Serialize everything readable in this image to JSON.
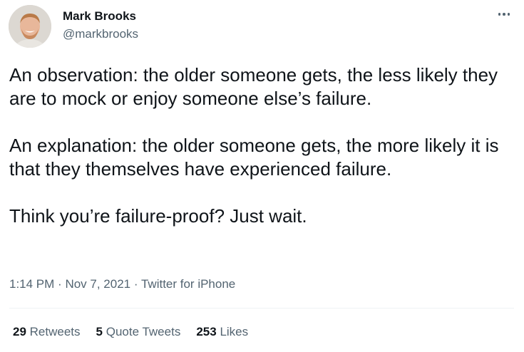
{
  "author": {
    "name": "Mark Brooks",
    "handle": "@markbrooks"
  },
  "tweet": {
    "paragraphs": [
      "An observation: the older someone gets, the less likely they are to mock or enjoy someone else’s failure.",
      "An explanation: the older someone gets, the more likely it is that they themselves have experienced failure.",
      "Think you’re failure-proof? Just wait."
    ]
  },
  "meta": {
    "time": "1:14 PM",
    "separator": "·",
    "date": "Nov 7, 2021",
    "source": "Twitter for iPhone"
  },
  "stats": {
    "retweets": {
      "count": "29",
      "label": "Retweets"
    },
    "quote_tweets": {
      "count": "5",
      "label": "Quote Tweets"
    },
    "likes": {
      "count": "253",
      "label": "Likes"
    }
  },
  "icons": {
    "more": "more-horizontal-icon",
    "avatar": "profile-photo"
  }
}
